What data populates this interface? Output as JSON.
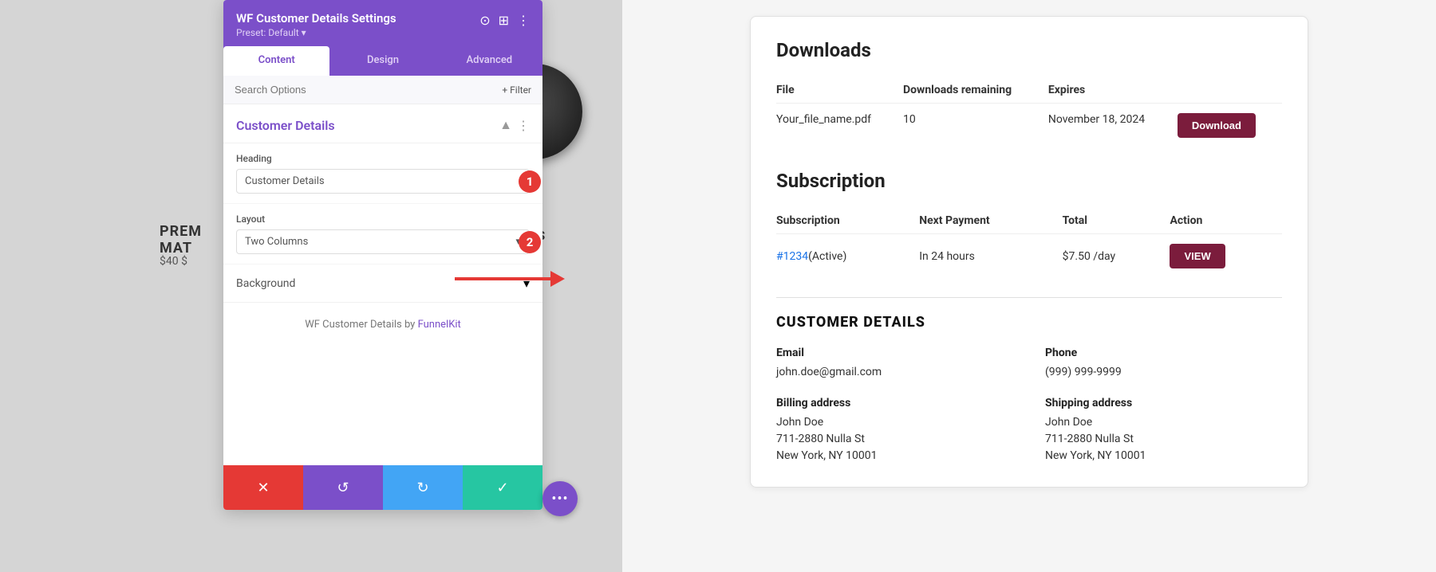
{
  "panel": {
    "title": "WF Customer Details Settings",
    "preset": "Preset: Default ▾",
    "tabs": [
      "Content",
      "Design",
      "Advanced"
    ],
    "active_tab": "Content",
    "search_placeholder": "Search Options",
    "filter_label": "+ Filter",
    "section_title": "Customer Details",
    "heading_label": "Heading",
    "heading_value": "Customer Details",
    "heading_badge": "1",
    "layout_label": "Layout",
    "layout_value": "Two Columns",
    "layout_badge": "2",
    "background_label": "Background",
    "footer_text": "WF Customer Details by",
    "footer_link": "FunnelKit",
    "actions": {
      "cancel": "✕",
      "undo": "↺",
      "redo": "↻",
      "confirm": "✓"
    }
  },
  "right": {
    "downloads_heading": "Downloads",
    "table": {
      "headers": [
        "File",
        "Downloads remaining",
        "Expires",
        ""
      ],
      "rows": [
        {
          "file": "Your_file_name.pdf",
          "downloads": "10",
          "expires": "November 18, 2024",
          "action": "Download"
        }
      ]
    },
    "subscription_heading": "Subscription",
    "sub_table": {
      "headers": [
        "Subscription",
        "Next Payment",
        "Total",
        "Action"
      ],
      "rows": [
        {
          "subscription": "#1234",
          "status": "(Active)",
          "next_payment": "In 24 hours",
          "total": "$7.50 /day",
          "action": "VIEW"
        }
      ]
    },
    "customer_details_heading": "CUSTOMER DETAILS",
    "email_label": "Email",
    "email_value": "john.doe@gmail.com",
    "phone_label": "Phone",
    "phone_value": "(999) 999-9999",
    "billing_label": "Billing address",
    "billing_lines": [
      "John Doe",
      "711-2880 Nulla St",
      "New York, NY 10001"
    ],
    "shipping_label": "Shipping address",
    "shipping_lines": [
      "John Doe",
      "711-2880 Nulla St",
      "New York, NY 10001"
    ]
  },
  "product": {
    "name_line1": "PREM",
    "name_line2": "MAT",
    "discs": "DISCS",
    "price": "$40 $"
  },
  "icons": {
    "focus": "⊙",
    "expand": "⊞",
    "more": "⋮",
    "chevron_down": "▾",
    "dots": "•••"
  }
}
